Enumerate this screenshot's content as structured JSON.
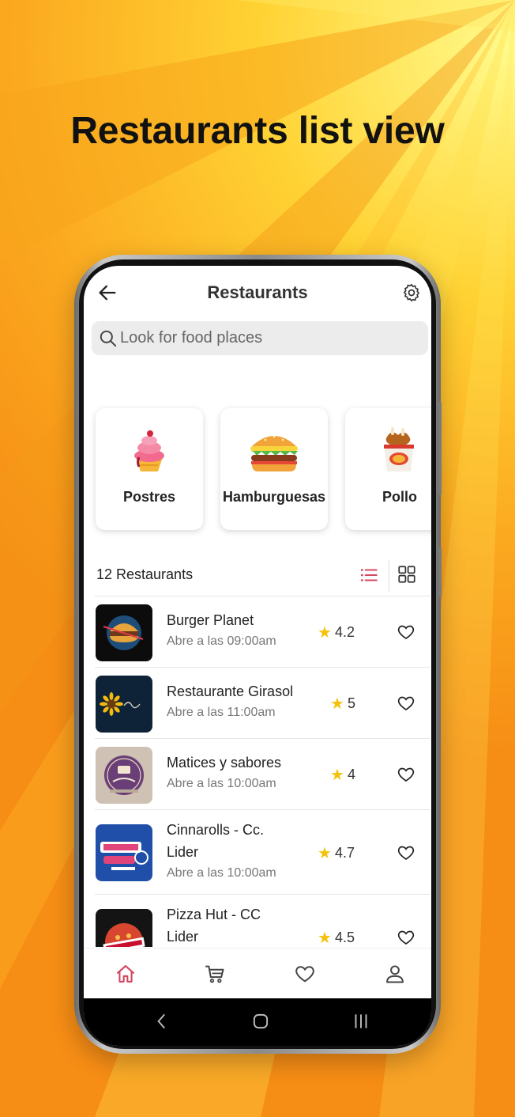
{
  "headline": "Restaurants list view",
  "app": {
    "title": "Restaurants",
    "search_placeholder": "Look for food places"
  },
  "categories": [
    {
      "label": "Postres",
      "icon": "cupcake-icon"
    },
    {
      "label": "Hamburguesas",
      "icon": "burger-icon"
    },
    {
      "label": "Pollo",
      "icon": "chicken-bucket-icon"
    }
  ],
  "list_header": {
    "count": "12 Restaurants",
    "active_view": "list"
  },
  "restaurants": [
    {
      "name": "Burger Planet",
      "hours": "Abre a las 09:00am",
      "rating": "4.2"
    },
    {
      "name": "Restaurante Girasol",
      "hours": "Abre a las 11:00am",
      "rating": "5"
    },
    {
      "name": "Matices y sabores",
      "hours": "Abre a las 10:00am",
      "rating": "4"
    },
    {
      "name": "Cinnarolls - Cc. Lider",
      "hours": "Abre a las 10:00am",
      "rating": "4.7"
    },
    {
      "name": "Pizza Hut - CC Lider",
      "hours": "",
      "rating": "4.5"
    }
  ],
  "bottom_nav": {
    "items": [
      "home-icon",
      "cart-icon",
      "heart-icon",
      "user-icon"
    ],
    "active": "home-icon"
  },
  "colors": {
    "accent": "#d4475f",
    "star": "#f4c20d",
    "background": "#f7a21c"
  }
}
